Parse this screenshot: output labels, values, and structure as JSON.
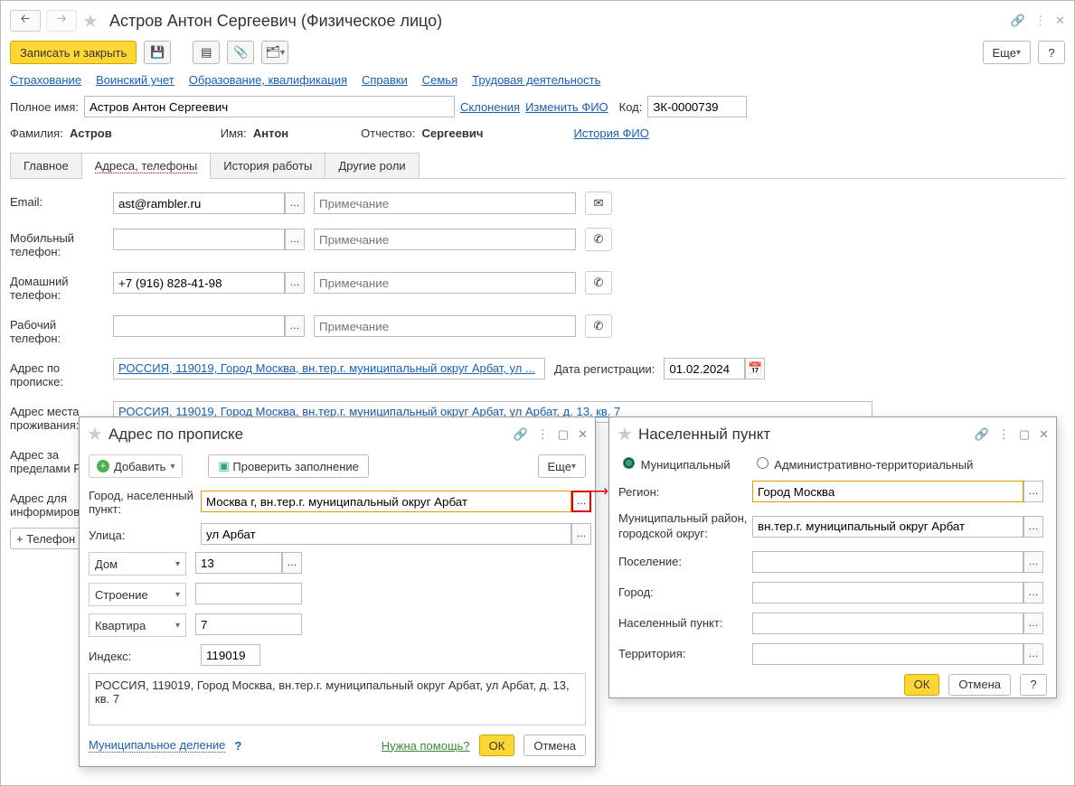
{
  "header": {
    "title": "Астров Антон Сергеевич (Физическое лицо)"
  },
  "toolbar": {
    "save_close": "Записать и закрыть",
    "more": "Еще"
  },
  "links": {
    "insurance": "Страхование",
    "military": "Воинский учет",
    "education": "Образование, квалификация",
    "references": "Справки",
    "family": "Семья",
    "employment": "Трудовая деятельность"
  },
  "name_row": {
    "label": "Полное имя:",
    "value": "Астров Антон Сергеевич",
    "declensions": "Склонения",
    "change_fio": "Изменить ФИО",
    "code_label": "Код:",
    "code": "ЗК-0000739"
  },
  "name_parts": {
    "surname_label": "Фамилия:",
    "surname": "Астров",
    "name_label": "Имя:",
    "name": "Антон",
    "patronymic_label": "Отчество:",
    "patronymic": "Сергеевич",
    "history": "История ФИО"
  },
  "tabs": {
    "main": "Главное",
    "addresses": "Адреса, телефоны",
    "work_history": "История работы",
    "other_roles": "Другие роли"
  },
  "fields": {
    "email_label": "Email:",
    "email": "ast@rambler.ru",
    "note_placeholder": "Примечание",
    "mobile_label": "Мобильный телефон:",
    "home_label": "Домашний телефон:",
    "home_value": "+7 (916) 828-41-98",
    "work_label": "Рабочий телефон:",
    "reg_addr_label": "Адрес по прописке:",
    "reg_addr": "РОССИЯ, 119019, Город Москва, вн.тер.г. муниципальный округ Арбат, ул ...",
    "reg_date_label": "Дата регистрации:",
    "reg_date": "01.02.2024",
    "res_addr_label": "Адрес места проживания:",
    "res_addr": "РОССИЯ, 119019, Город Москва, вн.тер.г. муниципальный округ Арбат, ул Арбат, д. 13, кв. 7",
    "abroad_label": "Адрес за пределами РФ:",
    "inform_label": "Адрес для информирования:",
    "add_phone_btn": "+ Телефон"
  },
  "modal_addr": {
    "title": "Адрес по прописке",
    "add": "Добавить",
    "check": "Проверить заполнение",
    "more": "Еще",
    "city_label": "Город, населенный пункт:",
    "city": "Москва г, вн.тер.г. муниципальный округ Арбат",
    "street_label": "Улица:",
    "street": "ул Арбат",
    "house_label": "Дом",
    "house": "13",
    "building_label": "Строение",
    "flat_label": "Квартира",
    "flat": "7",
    "index_label": "Индекс:",
    "index": "119019",
    "summary": "РОССИЯ, 119019, Город Москва, вн.тер.г. муниципальный округ Арбат, ул Арбат, д. 13, кв. 7",
    "municipal": "Муниципальное деление",
    "help": "Нужна помощь?",
    "ok": "ОК",
    "cancel": "Отмена"
  },
  "modal_place": {
    "title": "Населенный пункт",
    "radio_municipal": "Муниципальный",
    "radio_admin": "Административно-территориальный",
    "region_label": "Регион:",
    "region": "Город Москва",
    "district_label": "Муниципальный район, городской округ:",
    "district": "вн.тер.г. муниципальный округ Арбат",
    "settlement_label": "Поселение:",
    "city_label": "Город:",
    "locality_label": "Населенный пункт:",
    "territory_label": "Территория:",
    "ok": "ОК",
    "cancel": "Отмена"
  }
}
